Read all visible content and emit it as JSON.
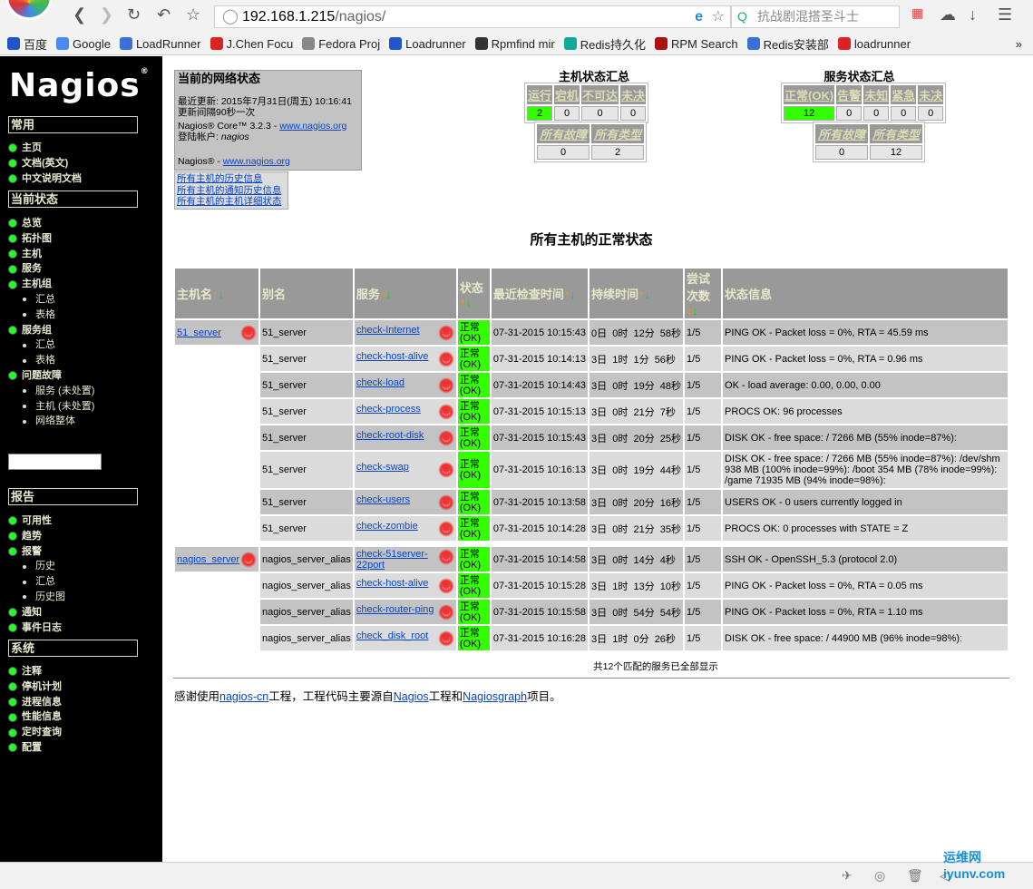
{
  "browser": {
    "url_host": "192.168.1.215",
    "url_path": "/nagios/",
    "search_placeholder": "抗战剧混搭圣斗士",
    "bookmarks": [
      "百度",
      "Google",
      "LoadRunner",
      "J.Chen Focu",
      "Fedora Proj",
      "Loadrunner",
      "Rpmfind mir",
      "Redis持久化",
      "RPM Search",
      "Redis安装部",
      "loadrunner"
    ],
    "more": "»"
  },
  "sidebar": {
    "logo": "Nagios",
    "sections": [
      {
        "title": "常用",
        "items": [
          {
            "label": "主页"
          },
          {
            "label": "文档(英文)"
          },
          {
            "label": "中文说明文档"
          }
        ]
      },
      {
        "title": "当前状态",
        "items": [
          {
            "label": "总览"
          },
          {
            "label": "拓扑图"
          },
          {
            "label": "主机"
          },
          {
            "label": "服务"
          },
          {
            "label": "主机组"
          },
          {
            "label": "汇总",
            "sub": true
          },
          {
            "label": "表格",
            "sub": true
          },
          {
            "label": "服务组"
          },
          {
            "label": "汇总",
            "sub": true
          },
          {
            "label": "表格",
            "sub": true
          },
          {
            "label": "问题故障"
          },
          {
            "label": "服务 (未处置)",
            "sub": true
          },
          {
            "label": "主机 (未处置)",
            "sub": true
          },
          {
            "label": "网络整体",
            "sub": true
          }
        ]
      },
      {
        "title": "报告",
        "items": [
          {
            "label": "可用性"
          },
          {
            "label": "趋势"
          },
          {
            "label": "报警"
          },
          {
            "label": "历史",
            "sub": true
          },
          {
            "label": "汇总",
            "sub": true
          },
          {
            "label": "历史图",
            "sub": true
          },
          {
            "label": "通知"
          },
          {
            "label": "事件日志"
          }
        ]
      },
      {
        "title": "系统",
        "items": [
          {
            "label": "注释"
          },
          {
            "label": "停机计划"
          },
          {
            "label": "进程信息"
          },
          {
            "label": "性能信息"
          },
          {
            "label": "定时查询"
          },
          {
            "label": "配置"
          }
        ]
      }
    ]
  },
  "netstatus": {
    "title": "当前的网络状态",
    "last_update": "最近更新: 2015年7月31日(周五) 10:16:41",
    "interval": "更新间隔90秒一次",
    "core_prefix": "Nagios® Core™ 3.2.3 - ",
    "core_link": "www.nagios.org",
    "user_prefix": "登陆帐户: ",
    "user": "nagios",
    "nagios_prefix": "Nagios® - ",
    "nagios_link": "www.nagios.org",
    "links": [
      "所有主机的历史信息",
      "所有主机的通知历史信息",
      "所有主机的主机详细状态"
    ]
  },
  "host_summary": {
    "title": "主机状态汇总",
    "headers": [
      "运行",
      "宕机",
      "不可达",
      "未决"
    ],
    "values": [
      "2",
      "0",
      "0",
      "0"
    ],
    "headers2": [
      "所有故障",
      "所有类型"
    ],
    "values2": [
      "0",
      "2"
    ]
  },
  "service_summary": {
    "title": "服务状态汇总",
    "headers": [
      "正常(OK)",
      "告警",
      "未知",
      "紧急",
      "未决"
    ],
    "values": [
      "12",
      "0",
      "0",
      "0",
      "0"
    ],
    "headers2": [
      "所有故障",
      "所有类型"
    ],
    "values2": [
      "0",
      "12"
    ]
  },
  "page_title": "所有主机的正常状态",
  "table": {
    "headers": [
      "主机名",
      "别名",
      "服务",
      "状态",
      "最近检查时间",
      "持续时间",
      "尝试次数",
      "状态信息"
    ],
    "rows": [
      {
        "host": "51_server",
        "alias": "51_server",
        "service": "check-Internet",
        "status": "正常 (OK)",
        "last": "07-31-2015 10:15:43",
        "dur": "0日  0时  12分  58秒",
        "att": "1/5",
        "info": "PING OK - Packet loss = 0%, RTA = 45.59 ms"
      },
      {
        "host": "",
        "alias": "51_server",
        "service": "check-host-alive",
        "status": "正常 (OK)",
        "last": "07-31-2015 10:14:13",
        "dur": "3日  1时  1分  56秒",
        "att": "1/5",
        "info": "PING OK - Packet loss = 0%, RTA = 0.96 ms"
      },
      {
        "host": "",
        "alias": "51_server",
        "service": "check-load",
        "status": "正常 (OK)",
        "last": "07-31-2015 10:14:43",
        "dur": "3日  0时  19分  48秒",
        "att": "1/5",
        "info": "OK - load average: 0.00, 0.00, 0.00"
      },
      {
        "host": "",
        "alias": "51_server",
        "service": "check-process",
        "status": "正常 (OK)",
        "last": "07-31-2015 10:15:13",
        "dur": "3日  0时  21分  7秒",
        "att": "1/5",
        "info": "PROCS OK: 96 processes"
      },
      {
        "host": "",
        "alias": "51_server",
        "service": "check-root-disk",
        "status": "正常 (OK)",
        "last": "07-31-2015 10:15:43",
        "dur": "3日  0时  20分  25秒",
        "att": "1/5",
        "info": "DISK OK - free space: / 7266 MB (55% inode=87%):"
      },
      {
        "host": "",
        "alias": "51_server",
        "service": "check-swap",
        "status": "正常 (OK)",
        "last": "07-31-2015 10:16:13",
        "dur": "3日  0时  19分  44秒",
        "att": "1/5",
        "info": "DISK OK - free space: / 7266 MB (55% inode=87%): /dev/shm 938 MB (100% inode=99%): /boot 354 MB (78% inode=99%): /game 71935 MB (94% inode=98%):"
      },
      {
        "host": "",
        "alias": "51_server",
        "service": "check-users",
        "status": "正常 (OK)",
        "last": "07-31-2015 10:13:58",
        "dur": "3日  0时  20分  16秒",
        "att": "1/5",
        "info": "USERS OK - 0 users currently logged in"
      },
      {
        "host": "",
        "alias": "51_server",
        "service": "check-zombie",
        "status": "正常 (OK)",
        "last": "07-31-2015 10:14:28",
        "dur": "3日  0时  21分  35秒",
        "att": "1/5",
        "info": "PROCS OK: 0 processes with STATE = Z"
      },
      {
        "host": "nagios_server",
        "alias": "nagios_server_alias",
        "service": "check-51server-22port",
        "status": "正常 (OK)",
        "last": "07-31-2015 10:14:58",
        "dur": "3日  0时  14分  4秒",
        "att": "1/5",
        "info": "SSH OK - OpenSSH_5.3 (protocol 2.0)"
      },
      {
        "host": "",
        "alias": "nagios_server_alias",
        "service": "check-host-alive",
        "status": "正常 (OK)",
        "last": "07-31-2015 10:15:28",
        "dur": "3日  1时  13分  10秒",
        "att": "1/5",
        "info": "PING OK - Packet loss = 0%, RTA = 0.05 ms"
      },
      {
        "host": "",
        "alias": "nagios_server_alias",
        "service": "check-router-ping",
        "status": "正常 (OK)",
        "last": "07-31-2015 10:15:58",
        "dur": "3日  0时  54分  54秒",
        "att": "1/5",
        "info": "PING OK - Packet loss = 0%, RTA = 1.10 ms"
      },
      {
        "host": "",
        "alias": "nagios_server_alias",
        "service": "check_disk_root",
        "status": "正常 (OK)",
        "last": "07-31-2015 10:16:28",
        "dur": "3日  1时  0分  26秒",
        "att": "1/5",
        "info": "DISK OK - free space: / 44900 MB (96% inode=98%):"
      }
    ]
  },
  "footer": {
    "count": "共12个匹配的服务已全部显示",
    "t1": "感谢使用",
    "l1": "nagios-cn",
    "t2": "工程，工程代码主要源自",
    "l2": "Nagios",
    "t3": "工程和",
    "l3": "Nagiosgraph",
    "t4": "项目。"
  },
  "watermark": "运维网 iyunv.com"
}
